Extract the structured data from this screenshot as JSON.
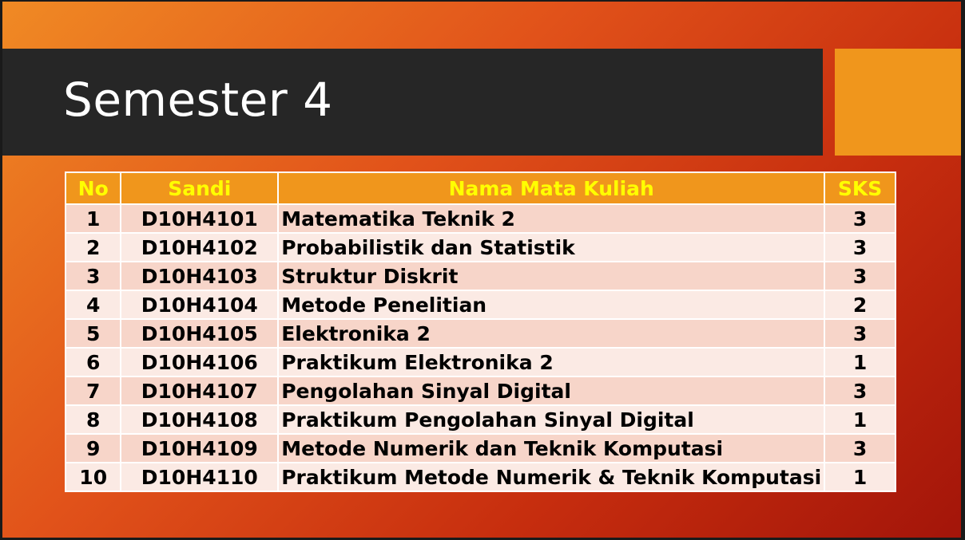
{
  "slide": {
    "title": "Semester 4"
  },
  "colors": {
    "title_bar": "#262626",
    "accent_box": "#f0961c",
    "header_bg": "#f0961c",
    "header_text": "#ffff00",
    "row_odd": "#f7d5c9",
    "row_even": "#fbeae4"
  },
  "table": {
    "headers": {
      "no": "No",
      "code": "Sandi",
      "name": "Nama Mata Kuliah",
      "sks": "SKS"
    },
    "rows": [
      {
        "no": "1",
        "code": "D10H4101",
        "name": "Matematika Teknik 2",
        "sks": "3"
      },
      {
        "no": "2",
        "code": "D10H4102",
        "name": "Probabilistik dan Statistik",
        "sks": "3"
      },
      {
        "no": "3",
        "code": "D10H4103",
        "name": "Struktur Diskrit",
        "sks": "3"
      },
      {
        "no": "4",
        "code": "D10H4104",
        "name": "Metode Penelitian",
        "sks": "2"
      },
      {
        "no": "5",
        "code": "D10H4105",
        "name": "Elektronika 2",
        "sks": "3"
      },
      {
        "no": "6",
        "code": "D10H4106",
        "name": "Praktikum Elektronika 2",
        "sks": "1"
      },
      {
        "no": "7",
        "code": "D10H4107",
        "name": "Pengolahan Sinyal Digital",
        "sks": "3"
      },
      {
        "no": "8",
        "code": "D10H4108",
        "name": "Praktikum Pengolahan Sinyal Digital",
        "sks": "1"
      },
      {
        "no": "9",
        "code": "D10H4109",
        "name": "Metode Numerik dan Teknik Komputasi",
        "sks": "3"
      },
      {
        "no": "10",
        "code": "D10H4110",
        "name": "Praktikum Metode Numerik & Teknik Komputasi",
        "sks": "1"
      }
    ]
  }
}
